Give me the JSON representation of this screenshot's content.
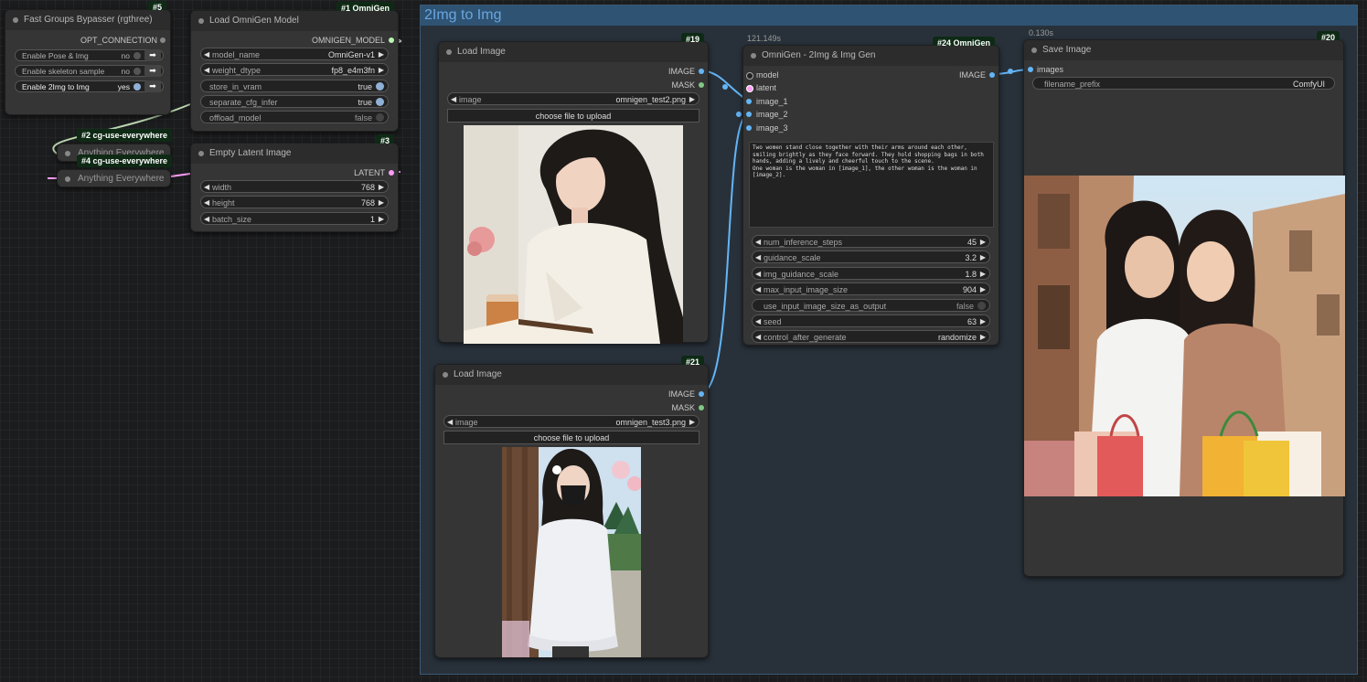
{
  "group": {
    "title": "2Img to Img"
  },
  "fgb": {
    "badge": "#5",
    "title": "Fast Groups Bypasser (rgthree)",
    "output": "OPT_CONNECTION",
    "rows": [
      {
        "label": "Enable Pose & Img",
        "value": "no"
      },
      {
        "label": "Enable skeleton sample",
        "value": "no"
      },
      {
        "label": "Enable 2Img to Img",
        "value": "yes"
      }
    ]
  },
  "load_model": {
    "badge": "#1 OmniGen",
    "title": "Load OmniGen Model",
    "output": "OMNIGEN_MODEL",
    "widgets": [
      {
        "label": "model_name",
        "value": "OmniGen-v1"
      },
      {
        "label": "weight_dtype",
        "value": "fp8_e4m3fn"
      },
      {
        "label": "store_in_vram",
        "value": "true"
      },
      {
        "label": "separate_cfg_infer",
        "value": "true"
      },
      {
        "label": "offload_model",
        "value": "false"
      }
    ]
  },
  "anything1": {
    "badge": "#2 cg-use-everywhere",
    "title": "Anything Everywhere"
  },
  "anything2": {
    "badge": "#4 cg-use-everywhere",
    "title": "Anything Everywhere"
  },
  "latent": {
    "badge": "#3",
    "title": "Empty Latent Image",
    "output": "LATENT",
    "widgets": [
      {
        "label": "width",
        "value": "768"
      },
      {
        "label": "height",
        "value": "768"
      },
      {
        "label": "batch_size",
        "value": "1"
      }
    ]
  },
  "load_image1": {
    "badge": "#19",
    "title": "Load Image",
    "outputs": [
      "IMAGE",
      "MASK"
    ],
    "image_label": "image",
    "image_value": "omnigen_test2.png",
    "upload": "choose file to upload"
  },
  "load_image2": {
    "badge": "#21",
    "title": "Load Image",
    "outputs": [
      "IMAGE",
      "MASK"
    ],
    "image_label": "image",
    "image_value": "omnigen_test3.png",
    "upload": "choose file to upload"
  },
  "omnigen": {
    "badge": "#24 OmniGen",
    "timer": "121.149s",
    "title": "OmniGen - 2Img & Img Gen",
    "inputs": [
      "model",
      "latent",
      "image_1",
      "image_2",
      "image_3"
    ],
    "output": "IMAGE",
    "prompt": "Two women stand close together with their arms around each other, smiling brightly as they face forward. They hold shopping bags in both hands, adding a lively and cheerful touch to the scene.\nOne woman is the woman in [image_1], the other woman is the woman in [image_2].",
    "widgets": [
      {
        "label": "num_inference_steps",
        "value": "45"
      },
      {
        "label": "guidance_scale",
        "value": "3.2"
      },
      {
        "label": "img_guidance_scale",
        "value": "1.8"
      },
      {
        "label": "max_input_image_size",
        "value": "904"
      },
      {
        "label": "use_input_image_size_as_output",
        "value": "false"
      },
      {
        "label": "seed",
        "value": "63"
      },
      {
        "label": "control_after_generate",
        "value": "randomize"
      }
    ]
  },
  "save_image": {
    "badge": "#20",
    "timer": "0.130s",
    "title": "Save Image",
    "input": "images",
    "widget": {
      "label": "filename_prefix",
      "value": "ComfyUI"
    }
  },
  "colors": {
    "image_slot": "#64b5f6",
    "mask_slot": "#81c784",
    "latent_slot": "#ff9cf9",
    "model_slot": "#b39ddb",
    "wire_blue": "#64b5f6",
    "wire_pink": "#ff9cf9"
  }
}
